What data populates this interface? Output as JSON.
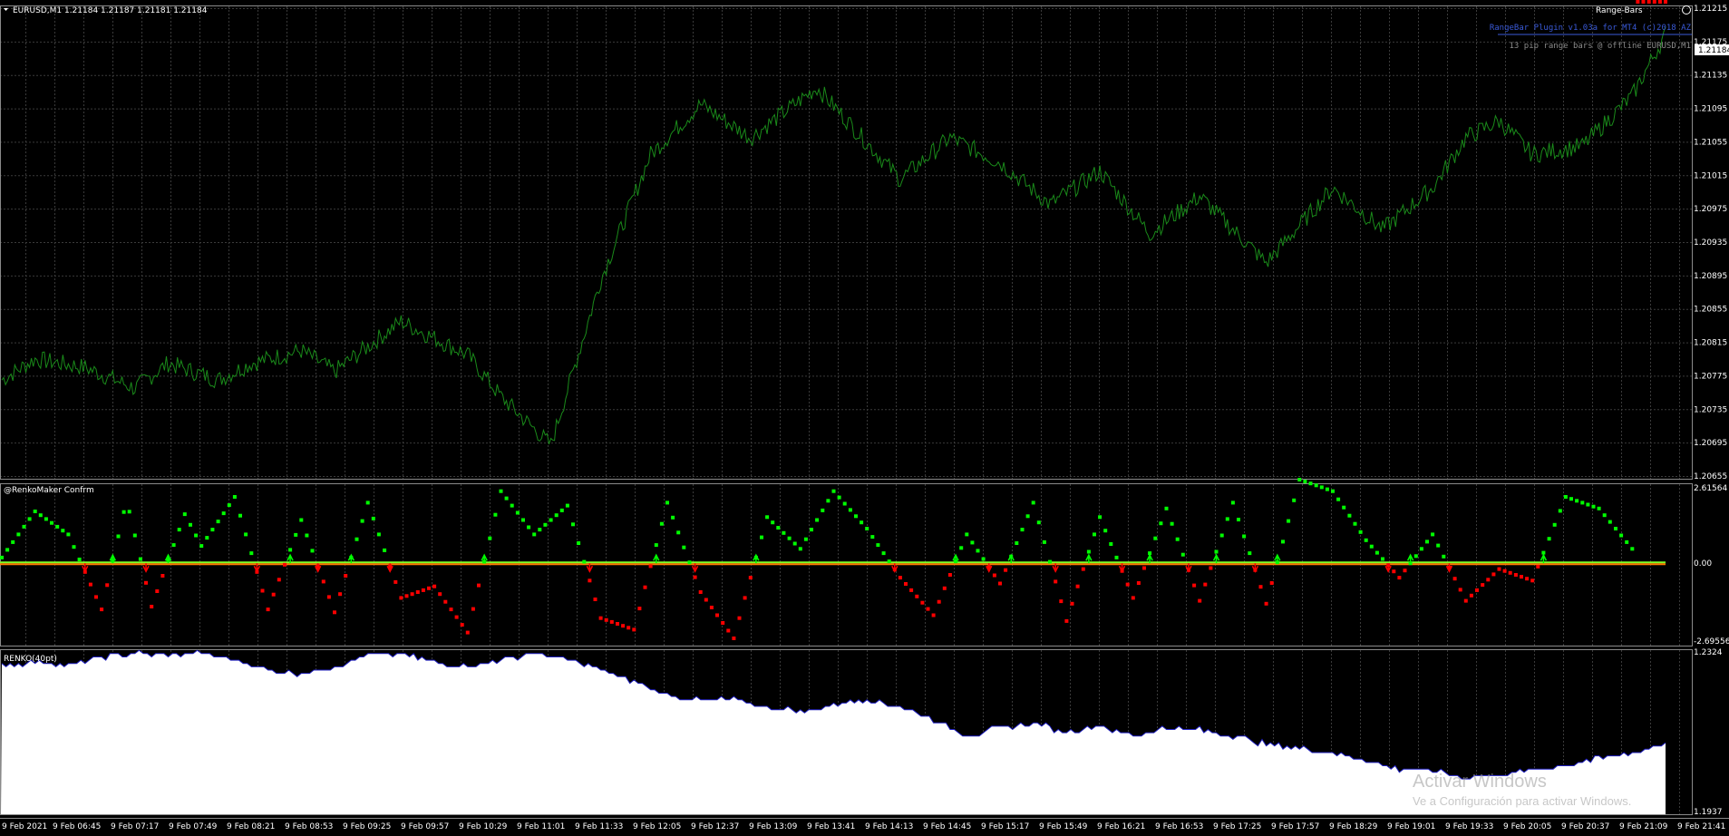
{
  "header": {
    "symbol_line": "EURUSD,M1  1.21184 1.21187 1.21181 1.21184",
    "indicator_badge": "Range-Bars",
    "plugin_line": "RangeBar Plugin v1.03a for MT4 (c)2018 AZ",
    "info_line": "13 pip range bars @ offline EURUSD,M1"
  },
  "colors": {
    "background": "#000000",
    "grid": "#3a3a3a",
    "price_line": "#1a8a1a",
    "osc_up": "#00ff00",
    "osc_down": "#ff0000",
    "zero_line_green": "#7dff2a",
    "zero_line_orange": "#ff7a00",
    "renko_fill": "#ffffff",
    "renko_edge": "#2020c0"
  },
  "watermark": {
    "line1": "Activar Windows",
    "line2": "Ve a Configuración para activar Windows."
  },
  "chart_data": [
    {
      "type": "line",
      "panel": "price",
      "ylim": [
        1.20655,
        1.21215
      ],
      "ytick_labels": [
        "1.21215",
        "1.21175",
        "1.21135",
        "1.21095",
        "1.21055",
        "1.21015",
        "1.20975",
        "1.20935",
        "1.20895",
        "1.20855",
        "1.20815",
        "1.20775",
        "1.20735",
        "1.20695",
        "1.20655"
      ],
      "current_price_label": "1.21184",
      "x": [
        0,
        2,
        5,
        8,
        10,
        13,
        15,
        18,
        20,
        24,
        28,
        30,
        33,
        36,
        39,
        42,
        45,
        49,
        54,
        57,
        60,
        63,
        66,
        69,
        72,
        76,
        80,
        83,
        86,
        88,
        90,
        92,
        95,
        98,
        100
      ],
      "series": [
        {
          "values": [
            1.2077,
            1.20795,
            1.20785,
            1.2076,
            1.2079,
            1.2077,
            1.2079,
            1.20805,
            1.2078,
            1.2084,
            1.208,
            1.2075,
            1.20692,
            1.2089,
            1.2104,
            1.211,
            1.2106,
            1.2112,
            1.2101,
            1.2106,
            1.2103,
            1.2098,
            1.2102,
            1.20945,
            1.2099,
            1.2091,
            1.21,
            1.2095,
            1.21,
            1.2106,
            1.2108,
            1.2104,
            1.2105,
            1.2111,
            1.21184
          ]
        }
      ]
    },
    {
      "type": "line",
      "panel": "oscillator",
      "title": "@RenkoMaker Confrm",
      "ylim": [
        -2.69556,
        2.61564
      ],
      "ytick_labels": [
        "2.61564",
        "0.00",
        "-2.69556"
      ],
      "x": [
        0,
        2,
        4,
        6,
        7.5,
        9,
        11,
        12,
        14,
        16,
        18,
        20,
        22,
        24,
        26,
        28,
        30,
        32,
        34,
        36,
        38,
        40,
        42,
        44,
        46,
        48,
        50,
        52,
        54,
        56,
        58,
        60,
        62,
        64,
        66,
        68,
        70,
        72,
        74,
        76,
        78,
        80,
        82,
        84,
        86,
        88,
        90,
        92,
        94,
        96,
        98,
        100
      ],
      "series": [
        {
          "values": [
            0.2,
            1.8,
            1.0,
            -1.6,
            2.2,
            -1.5,
            1.7,
            0.6,
            2.3,
            -1.6,
            1.5,
            -1.7,
            2.1,
            -1.2,
            -0.8,
            -2.4,
            2.5,
            1.0,
            2.0,
            -1.9,
            -2.3,
            2.1,
            -1.0,
            -2.6,
            1.6,
            0.5,
            2.5,
            1.2,
            -0.5,
            -1.8,
            1.0,
            -0.7,
            2.1,
            -2.0,
            1.6,
            -1.2,
            1.9,
            -1.3,
            2.1,
            -1.4,
            2.9,
            2.5,
            0.8,
            -0.5,
            1.0,
            -1.3,
            -0.2,
            -0.6,
            2.3,
            1.9,
            0.5
          ]
        }
      ]
    },
    {
      "type": "area",
      "panel": "renko",
      "title": "RENKO(40pt)",
      "ylim": [
        1.1937,
        1.2324
      ],
      "ytick_labels": [
        "1.2324",
        "1.1937"
      ],
      "x": [
        0,
        2,
        4,
        6,
        8,
        10,
        12,
        14,
        16,
        18,
        20,
        22,
        24,
        26,
        28,
        30,
        32,
        34,
        36,
        38,
        40,
        42,
        44,
        46,
        48,
        50,
        52,
        54,
        56,
        58,
        60,
        62,
        64,
        66,
        68,
        70,
        72,
        74,
        76,
        78,
        80,
        82,
        84,
        86,
        88,
        90,
        92,
        94,
        96,
        98,
        100
      ],
      "series": [
        {
          "values": [
            1.229,
            1.23,
            1.2292,
            1.231,
            1.2322,
            1.2315,
            1.232,
            1.2305,
            1.228,
            1.227,
            1.229,
            1.2315,
            1.232,
            1.23,
            1.229,
            1.2305,
            1.2322,
            1.2305,
            1.228,
            1.225,
            1.222,
            1.2205,
            1.221,
            1.219,
            1.218,
            1.2195,
            1.221,
            1.219,
            1.216,
            1.212,
            1.214,
            1.215,
            1.213,
            1.2145,
            1.212,
            1.214,
            1.2135,
            1.212,
            1.21,
            1.209,
            1.208,
            1.206,
            1.204,
            1.2035,
            1.202,
            1.2025,
            1.204,
            1.205,
            1.2065,
            1.208,
            1.21
          ]
        }
      ]
    }
  ],
  "x_axis": {
    "tick_labels": [
      "9 Feb 2021",
      "9 Feb 06:45",
      "9 Feb 07:17",
      "9 Feb 07:49",
      "9 Feb 08:21",
      "9 Feb 08:53",
      "9 Feb 09:25",
      "9 Feb 09:57",
      "9 Feb 10:29",
      "9 Feb 11:01",
      "9 Feb 11:33",
      "9 Feb 12:05",
      "9 Feb 12:37",
      "9 Feb 13:09",
      "9 Feb 13:41",
      "9 Feb 14:13",
      "9 Feb 14:45",
      "9 Feb 15:17",
      "9 Feb 15:49",
      "9 Feb 16:21",
      "9 Feb 16:53",
      "9 Feb 17:25",
      "9 Feb 17:57",
      "9 Feb 18:29",
      "9 Feb 19:01",
      "9 Feb 19:33",
      "9 Feb 20:05",
      "9 Feb 20:37",
      "9 Feb 21:09",
      "9 Feb 21:41"
    ]
  }
}
